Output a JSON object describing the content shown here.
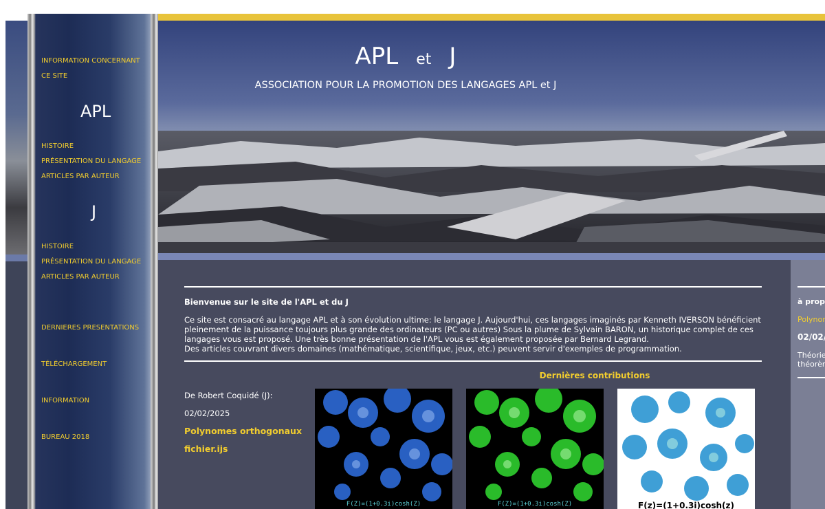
{
  "sidebar": {
    "info_site_line1": "INFORMATION CONCERNANT",
    "info_site_line2": "CE SITE",
    "apl_title": "APL",
    "apl_links": [
      "HISTOIRE",
      "PRÉSENTATION DU LANGAGE",
      "ARTICLES PAR AUTEUR"
    ],
    "j_title": "J",
    "j_links": [
      "HISTOIRE",
      "PRÉSENTATION DU LANGAGE",
      "ARTICLES PAR AUTEUR"
    ],
    "other_links": [
      "DERNIERES PRESENTATIONS",
      "TÉLÉCHARGEMENT",
      "INFORMATION",
      "BUREAU 2018"
    ]
  },
  "header": {
    "title_apl": "APL",
    "title_et": "et",
    "title_j": "J",
    "subtitle": "ASSOCIATION POUR LA PROMOTION DES LANGAGES APL et J"
  },
  "welcome": {
    "title": "Bienvenue sur le site de l'APL et du J",
    "paragraph": "Ce site est consacré au langage APL et à son évolution ultime: le langage J. Aujourd'hui, ces langages imaginés par Kenneth IVERSON bénéficient pleinement de la puissance toujours plus grande des ordinateurs (PC ou autres) Sous la plume de Sylvain BARON, un historique complet de ces langages vous est proposé. Une très bonne présentation de l'APL vous est également proposée par Bernard Legrand.",
    "paragraph2": "Des articles couvrant divers domaines (mathématique, scientifique, jeux, etc.) peuvent servir d'exemples de programmation."
  },
  "contributions": {
    "title": "Dernières contributions",
    "author": "De Robert Coquidé (J):",
    "date": "02/02/2025",
    "link1": "Polynomes orthogonaux",
    "link2": "fichier.ijs",
    "images": [
      {
        "caption": "F(Z)=(1+0.3i)cosh(Z)",
        "color": "#2e6bd8",
        "bg": "#000000",
        "caption_color": "#5fd3d8"
      },
      {
        "caption": "F(Z)=(1+0.3i)cosh(Z)",
        "color": "#2fd02f",
        "bg": "#000000",
        "caption_color": "#5fd3d8"
      },
      {
        "caption": "F(z)=(1+0.3i)cosh(z)",
        "color": "#1e8fd0",
        "bg": "#ffffff",
        "caption_color": "#000000"
      }
    ]
  },
  "right_column": {
    "line1": "à propo",
    "line2": "Polynom",
    "line3": "02/02/",
    "line4": "Théorie",
    "line5": "théorèm"
  },
  "colors": {
    "accent": "#f2cd2e",
    "main_bg": "#474a5e",
    "sidebar_bg": "#1d2c55"
  }
}
